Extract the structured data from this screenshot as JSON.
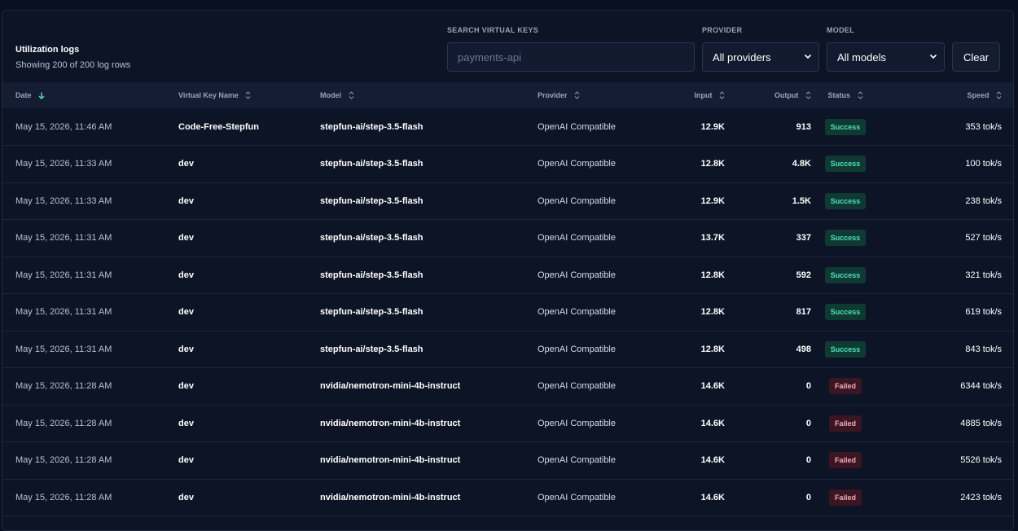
{
  "header": {
    "title": "Utilization logs",
    "subtitle": "Showing 200 of 200 log rows"
  },
  "filters": {
    "search_label": "SEARCH VIRTUAL KEYS",
    "search_placeholder": "payments-api",
    "provider_label": "PROVIDER",
    "provider_value": "All providers",
    "model_label": "MODEL",
    "model_value": "All models",
    "clear_label": "Clear"
  },
  "columns": {
    "date": "Date",
    "key": "Virtual Key Name",
    "model": "Model",
    "provider": "Provider",
    "input": "Input",
    "output": "Output",
    "status": "Status",
    "speed": "Speed"
  },
  "colors": {
    "success_text": "#4fe0b5",
    "success_bg": "#0f3a34",
    "failed_text": "#f3a9b6",
    "failed_bg": "#3a1622",
    "accent_sort": "#4fe0b5"
  },
  "rows": [
    {
      "date": "May 15, 2026, 11:46 AM",
      "key": "Code-Free-Stepfun",
      "model": "stepfun-ai/step-3.5-flash",
      "provider": "OpenAI Compatible",
      "input": "12.9K",
      "output": "913",
      "status": "Success",
      "speed": "353 tok/s"
    },
    {
      "date": "May 15, 2026, 11:33 AM",
      "key": "dev",
      "model": "stepfun-ai/step-3.5-flash",
      "provider": "OpenAI Compatible",
      "input": "12.8K",
      "output": "4.8K",
      "status": "Success",
      "speed": "100 tok/s"
    },
    {
      "date": "May 15, 2026, 11:33 AM",
      "key": "dev",
      "model": "stepfun-ai/step-3.5-flash",
      "provider": "OpenAI Compatible",
      "input": "12.9K",
      "output": "1.5K",
      "status": "Success",
      "speed": "238 tok/s"
    },
    {
      "date": "May 15, 2026, 11:31 AM",
      "key": "dev",
      "model": "stepfun-ai/step-3.5-flash",
      "provider": "OpenAI Compatible",
      "input": "13.7K",
      "output": "337",
      "status": "Success",
      "speed": "527 tok/s"
    },
    {
      "date": "May 15, 2026, 11:31 AM",
      "key": "dev",
      "model": "stepfun-ai/step-3.5-flash",
      "provider": "OpenAI Compatible",
      "input": "12.8K",
      "output": "592",
      "status": "Success",
      "speed": "321 tok/s"
    },
    {
      "date": "May 15, 2026, 11:31 AM",
      "key": "dev",
      "model": "stepfun-ai/step-3.5-flash",
      "provider": "OpenAI Compatible",
      "input": "12.8K",
      "output": "817",
      "status": "Success",
      "speed": "619 tok/s"
    },
    {
      "date": "May 15, 2026, 11:31 AM",
      "key": "dev",
      "model": "stepfun-ai/step-3.5-flash",
      "provider": "OpenAI Compatible",
      "input": "12.8K",
      "output": "498",
      "status": "Success",
      "speed": "843 tok/s"
    },
    {
      "date": "May 15, 2026, 11:28 AM",
      "key": "dev",
      "model": "nvidia/nemotron-mini-4b-instruct",
      "provider": "OpenAI Compatible",
      "input": "14.6K",
      "output": "0",
      "status": "Failed",
      "speed": "6344 tok/s"
    },
    {
      "date": "May 15, 2026, 11:28 AM",
      "key": "dev",
      "model": "nvidia/nemotron-mini-4b-instruct",
      "provider": "OpenAI Compatible",
      "input": "14.6K",
      "output": "0",
      "status": "Failed",
      "speed": "4885 tok/s"
    },
    {
      "date": "May 15, 2026, 11:28 AM",
      "key": "dev",
      "model": "nvidia/nemotron-mini-4b-instruct",
      "provider": "OpenAI Compatible",
      "input": "14.6K",
      "output": "0",
      "status": "Failed",
      "speed": "5526 tok/s"
    },
    {
      "date": "May 15, 2026, 11:28 AM",
      "key": "dev",
      "model": "nvidia/nemotron-mini-4b-instruct",
      "provider": "OpenAI Compatible",
      "input": "14.6K",
      "output": "0",
      "status": "Failed",
      "speed": "2423 tok/s"
    }
  ]
}
